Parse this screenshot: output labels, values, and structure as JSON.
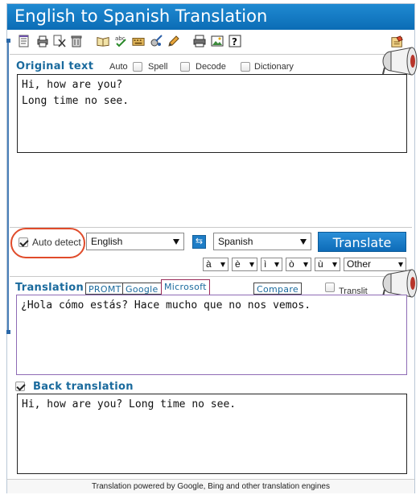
{
  "app": {
    "title": "English to Spanish Translation"
  },
  "toolbar": {
    "icons": [
      "notepad-icon",
      "printer-icon",
      "cut-icon",
      "trash-icon",
      "book-icon",
      "spellcheck-icon",
      "keyboard-icon",
      "tools-icon",
      "pencil-icon",
      "print-icon",
      "image-icon",
      "help-icon",
      "settings-icon"
    ]
  },
  "original": {
    "label": "Original text",
    "options": {
      "auto": "Auto",
      "spell": "Spell",
      "decode": "Decode",
      "dictionary": "Dictionary"
    },
    "text": "Hi, how are you?\nLong time no see."
  },
  "controls": {
    "auto_detect": "Auto detect",
    "source_lang": "English",
    "target_lang": "Spanish",
    "translate": "Translate",
    "swap_symbol": "⇆",
    "accents": [
      "à",
      "è",
      "ì",
      "ò",
      "ù"
    ],
    "other": "Other"
  },
  "translation": {
    "label": "Translation",
    "tabs": [
      "PROMT",
      "Google",
      "Microsoft"
    ],
    "active_tab": "Microsoft",
    "compare": "Compare",
    "translit": "Translit",
    "text": "¿Hola cómo estás? Hace mucho que no nos vemos."
  },
  "back": {
    "label": "Back translation",
    "text": "Hi, how are you? Long time no see."
  },
  "footer": {
    "text": "Translation powered by Google, Bing and other translation engines"
  },
  "colors": {
    "title_bg": "#0b6cb5",
    "label_blue": "#1a6a9d",
    "highlight_red": "#e04b2a",
    "active_tab_border": "#9b2a58",
    "translation_box_border": "#8e6bb5"
  }
}
